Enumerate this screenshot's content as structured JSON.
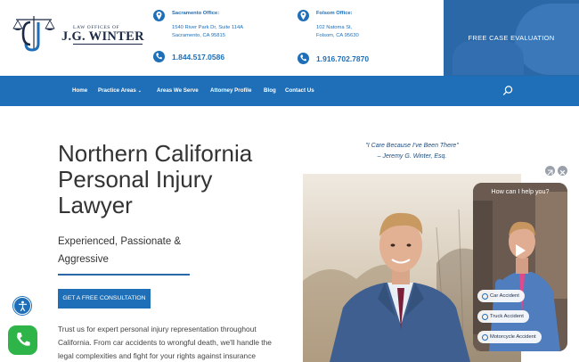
{
  "header": {
    "logo_small": "LAW OFFICES OF",
    "logo_big": "J.G. WINTER",
    "offices": [
      {
        "title": "Sacramento Office:",
        "line1": "1540 River Park Dr, Suite 114A",
        "line2": "Sacramento, CA 95815",
        "phone": "1.844.517.0586"
      },
      {
        "title": "Folsom Office:",
        "line1": "102 Natoma St,",
        "line2": "Folsom, CA 95630",
        "phone": "1.916.702.7870"
      }
    ],
    "cta": "FREE CASE EVALUATION"
  },
  "nav": {
    "items": [
      "Home",
      "Practice Areas",
      "Areas We Serve",
      "Attorney Profile",
      "Blog",
      "Contact Us"
    ],
    "dropdown_marker": "⌄"
  },
  "hero": {
    "title": "Northern California Personal Injury Lawyer",
    "subtitle": "Experienced, Passionate & Aggressive",
    "button": "GET A FREE CONSULTATION",
    "body": "Trust us for expert personal injury representation throughout California. From car accidents to wrongful death, we'll handle the legal complexities and fight for your rights against insurance companies. Your health and recovery should be our focus."
  },
  "quote": {
    "text": "\"I Care Because I've Been There\"",
    "author": "– Jeremy G. Winter, Esq."
  },
  "widget": {
    "question": "How can I help you?",
    "chips": [
      "Car Accident",
      "Truck Accident",
      "Motorcycle Accident"
    ]
  },
  "colors": {
    "brand_blue": "#1e6fb8",
    "dark_navy": "#1c2a45",
    "call_green": "#2fb44a"
  },
  "icons": [
    "location-pin-icon",
    "phone-icon",
    "search-icon",
    "play-icon",
    "expand-icon",
    "close-icon",
    "accessibility-icon",
    "call-icon"
  ]
}
